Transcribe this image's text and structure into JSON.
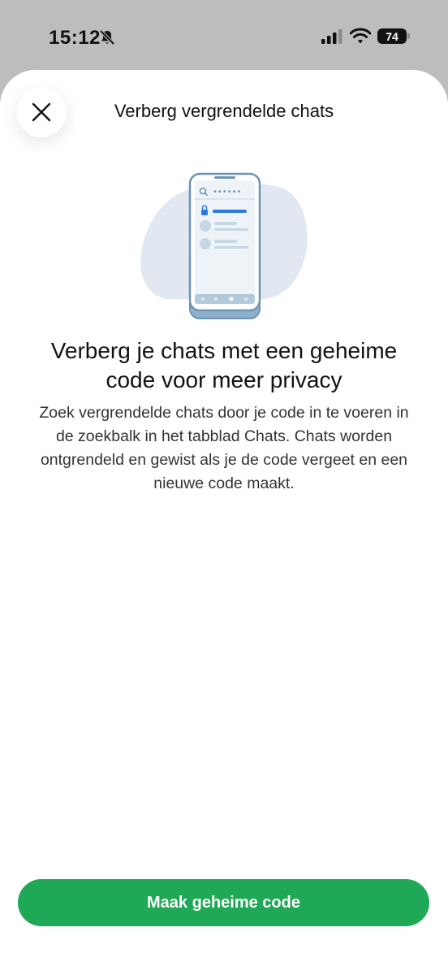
{
  "status_bar": {
    "time": "15:12",
    "battery": "74",
    "icons": [
      "bell-slash-icon",
      "signal-icon",
      "wifi-icon",
      "battery-icon"
    ]
  },
  "sheet": {
    "title": "Verberg vergrendelde chats",
    "close_icon": "close-icon"
  },
  "content": {
    "headline": "Verberg je chats met een geheime code voor meer privacy",
    "description": "Zoek vergrendelde chats door je code in te voeren in de zoekbalk in het tabblad Chats. Chats worden ontgrendeld en gewist als je de code vergeet en een nieuwe code maakt.",
    "illustration": {
      "search_text": "••••••",
      "icons": [
        "search-icon",
        "lock-icon"
      ]
    }
  },
  "actions": {
    "primary_label": "Maak geheime code"
  },
  "colors": {
    "accent": "#1fa855",
    "illustration_blob": "#e1e8f1",
    "illustration_stroke": "#6d94b4",
    "illustration_highlight": "#2d7be0"
  }
}
